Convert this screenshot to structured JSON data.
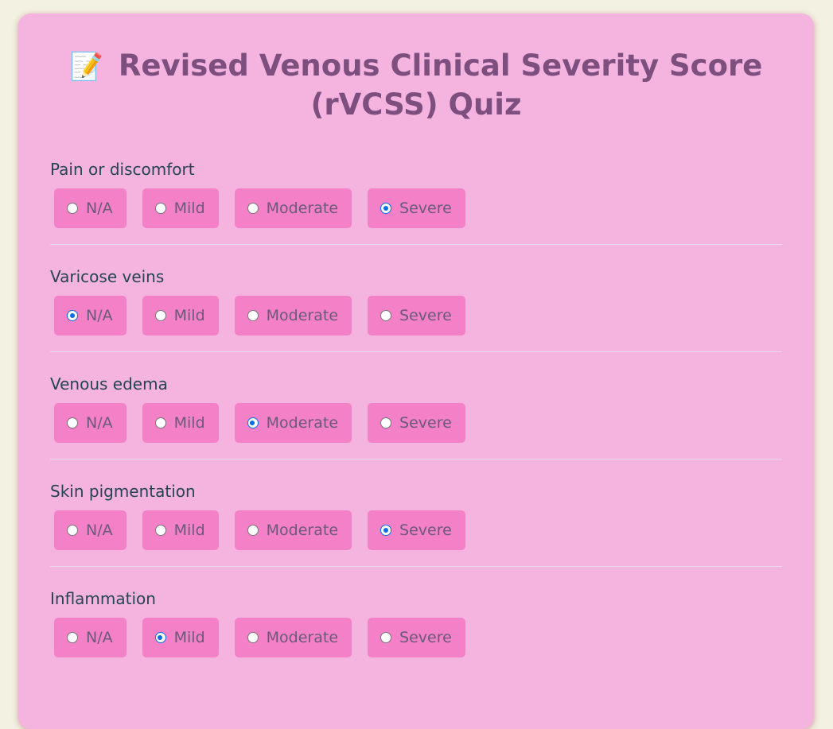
{
  "page": {
    "title": "Revised Venous Clinical Severity Score (rVCSS) Quiz",
    "title_icon": "memo-pencil-icon"
  },
  "questions": [
    {
      "label": "Pain or discomfort",
      "options": [
        "N/A",
        "Mild",
        "Moderate",
        "Severe"
      ],
      "selected": "Severe"
    },
    {
      "label": "Varicose veins",
      "options": [
        "N/A",
        "Mild",
        "Moderate",
        "Severe"
      ],
      "selected": "N/A"
    },
    {
      "label": "Venous edema",
      "options": [
        "N/A",
        "Mild",
        "Moderate",
        "Severe"
      ],
      "selected": "Moderate"
    },
    {
      "label": "Skin pigmentation",
      "options": [
        "N/A",
        "Mild",
        "Moderate",
        "Severe"
      ],
      "selected": "Severe"
    },
    {
      "label": "Inflammation",
      "options": [
        "N/A",
        "Mild",
        "Moderate",
        "Severe"
      ],
      "selected": "Mild"
    }
  ],
  "colors": {
    "page_background": "#f3f1e1",
    "card_background": "#f5b3e0",
    "option_background": "#f481c8",
    "title_text": "#7d4f7f",
    "question_text": "#254555",
    "radio_accent": "#0a6ee0"
  }
}
